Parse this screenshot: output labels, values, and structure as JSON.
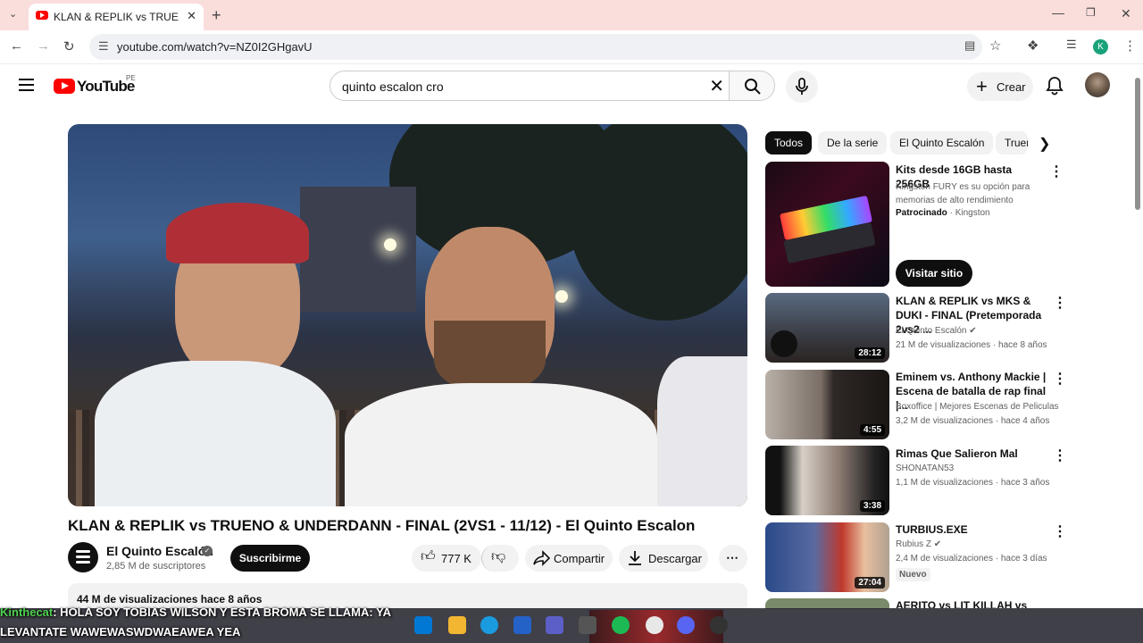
{
  "browser": {
    "tab_title": "KLAN & REPLIK vs TRUENO & U",
    "url": "youtube.com/watch?v=NZ0I2GHgavU",
    "profile_initial": "K"
  },
  "header": {
    "logo_text": "YouTube",
    "country_code": "PE",
    "search_value": "quinto escalon cro",
    "create_label": "Crear"
  },
  "video": {
    "title": "KLAN & REPLIK vs TRUENO & UNDERDANN - FINAL (2VS1 - 11/12) - El Quinto Escalon",
    "channel_name": "El Quinto Escalón",
    "subscribers": "2,85 M de suscriptores",
    "subscribe_label": "Suscribirme",
    "likes": "777 K",
    "share_label": "Compartir",
    "download_label": "Descargar",
    "description_summary": "44 M de visualizaciones  hace 8 años"
  },
  "chips": [
    "Todos",
    "De la serie",
    "El Quinto Escalón",
    "Trueno"
  ],
  "ad": {
    "title": "Kits desde 16GB hasta 256GB",
    "description": "Kingston FURY es su opción para memorias de alto rendimiento",
    "sponsored": "Patrocinado",
    "advertiser": "Kingston",
    "cta": "Visitar sitio"
  },
  "related": [
    {
      "title": "KLAN & REPLIK vs MKS & DUKI - FINAL (Pretemporada 2vs2 ...",
      "channel": "El Quinto Escalón",
      "meta": "21 M de visualizaciones · hace 8 años",
      "duration": "28:12"
    },
    {
      "title": "Eminem vs. Anthony Mackie | Escena de batalla de rap final |...",
      "channel": "Boxoffice | Mejores Escenas de Peliculas",
      "meta": "3,2 M de visualizaciones · hace 4 años",
      "duration": "4:55"
    },
    {
      "title": "Rimas Que Salieron Mal",
      "channel": "SHONATAN53",
      "meta": "1,1 M de visualizaciones · hace 3 años",
      "duration": "3:38"
    },
    {
      "title": "TURBIUS.EXE",
      "channel": "Rubius Z",
      "meta": "2,4 M de visualizaciones · hace 3 días",
      "duration": "27:04",
      "badge": "Nuevo"
    },
    {
      "title": "AERITO vs LIT KILLAH vs"
    }
  ],
  "chat": {
    "user": "Kinthecat",
    "message": ": HOLA SOY TOBIAS WILSON Y ESTA BROMA SE LLAMA: YA LEVANTATE WAWEWASWDWAEAWEA YEA"
  },
  "icons": [
    "menu-icon",
    "search-icon",
    "mic-icon",
    "plus-icon",
    "bell-icon",
    "like-icon",
    "dislike-icon",
    "share-icon",
    "download-icon",
    "more-icon",
    "verified-icon",
    "chevron-right-icon"
  ],
  "colors": {
    "brand": "#ff0000",
    "tabbar": "#f9dedc",
    "chip_active": "#0f0f0f"
  }
}
